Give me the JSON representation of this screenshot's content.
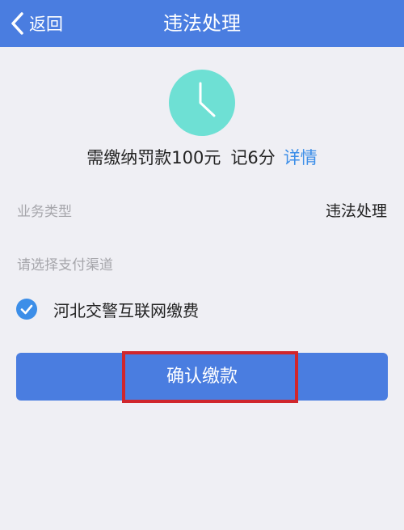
{
  "nav": {
    "back_label": "返回",
    "title": "违法处理"
  },
  "fine": {
    "text": "需缴纳罚款100元",
    "points": "记6分",
    "details_link": "详情"
  },
  "business_type": {
    "label": "业务类型",
    "value": "违法处理"
  },
  "payment": {
    "prompt": "请选择支付渠道",
    "channel": "河北交警互联网缴费",
    "channel_selected": true
  },
  "confirm_button": {
    "label": "确认缴款"
  },
  "icons": {
    "back": "chevron-left-icon",
    "clock": "clock-icon",
    "check": "check-circle-icon"
  },
  "colors": {
    "primary": "#4a7de0",
    "clock": "#6ee0d4",
    "link": "#3c8ee8",
    "highlight": "#d0262c"
  }
}
